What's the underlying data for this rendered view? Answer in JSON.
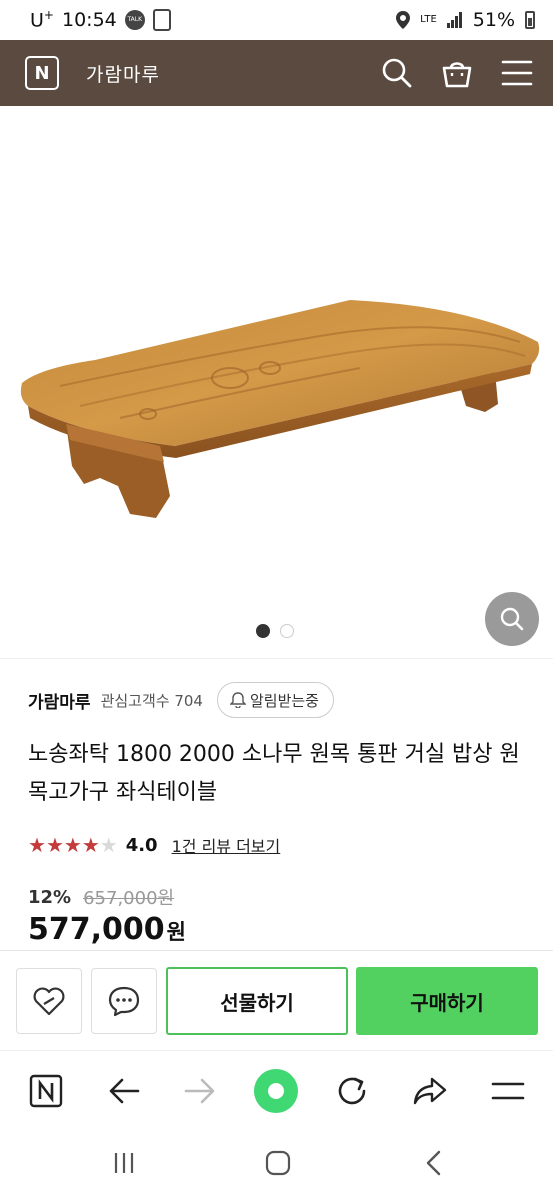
{
  "status": {
    "carrier": "U",
    "carrier_sup": "+",
    "time": "10:54",
    "talk_badge": "TALK",
    "network": "LTE",
    "battery": "51%"
  },
  "header": {
    "logo_letter": "N",
    "store_name": "가람마루",
    "icons": [
      "search-icon",
      "cart-icon",
      "menu-icon"
    ],
    "bg_color": "#5a4a40"
  },
  "gallery": {
    "image_count": 2,
    "active_index": 0
  },
  "seller": {
    "name": "가람마루",
    "followers": "관심고객수 704",
    "notify_label": "알림받는중"
  },
  "product": {
    "title": "노송좌탁 1800 2000 소나무 원목 통판 거실 밥상 원목고가구 좌식테이블",
    "rating": "4.0",
    "rating_stars": 4,
    "review_link": "1건 리뷰 더보기",
    "discount": "12%",
    "original_price": "657,000원",
    "price": "577,000",
    "price_unit": "원"
  },
  "actions": {
    "gift_label": "선물하기",
    "buy_label": "구매하기",
    "accent": "#52d160"
  },
  "browser_nav": {
    "icons": [
      "naver-home-icon",
      "back-arrow-icon",
      "forward-arrow-icon",
      "green-dot-icon",
      "refresh-icon",
      "share-icon",
      "menu-icon"
    ]
  },
  "system_nav": {
    "icons": [
      "recent-apps-icon",
      "home-icon",
      "back-icon"
    ]
  }
}
